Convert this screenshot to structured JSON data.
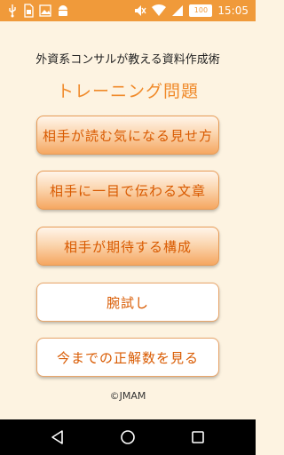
{
  "status_bar": {
    "time": "15:05",
    "battery_level": "100",
    "left_icons": [
      "usb-icon",
      "sim-icon",
      "photo-icon",
      "android-icon"
    ],
    "right_icons": [
      "mute-icon",
      "wifi-icon",
      "signal-icon",
      "battery-icon"
    ]
  },
  "app": {
    "subtitle": "外資系コンサルが教える資料作成術",
    "title": "トレーニング問題",
    "copyright": "©JMAM"
  },
  "menu": [
    {
      "label": "相手が読む気になる見せ方",
      "style": "orange"
    },
    {
      "label": "相手に一目で伝わる文章",
      "style": "orange"
    },
    {
      "label": "相手が期待する構成",
      "style": "orange"
    },
    {
      "label": "腕試し",
      "style": "white"
    },
    {
      "label": "今までの正解数を見る",
      "style": "white"
    }
  ],
  "colors": {
    "status_bar": "#f09a3a",
    "background": "#fdf3e1",
    "accent": "#f08a2a",
    "button_text": "#d95a00"
  }
}
